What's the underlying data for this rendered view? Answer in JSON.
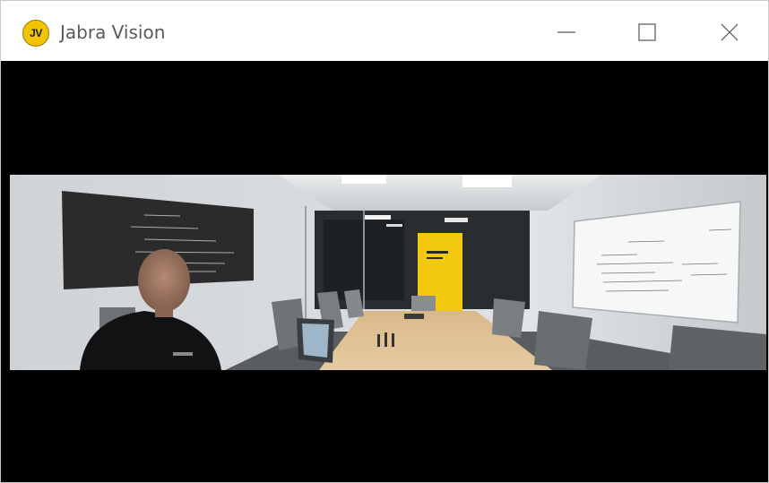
{
  "window": {
    "title": "Jabra Vision",
    "logo_text": "JV",
    "logo_color": "#f2c300",
    "controls": [
      "minimize-icon",
      "maximize-icon",
      "close-icon"
    ]
  },
  "video": {
    "background": "#000000"
  }
}
